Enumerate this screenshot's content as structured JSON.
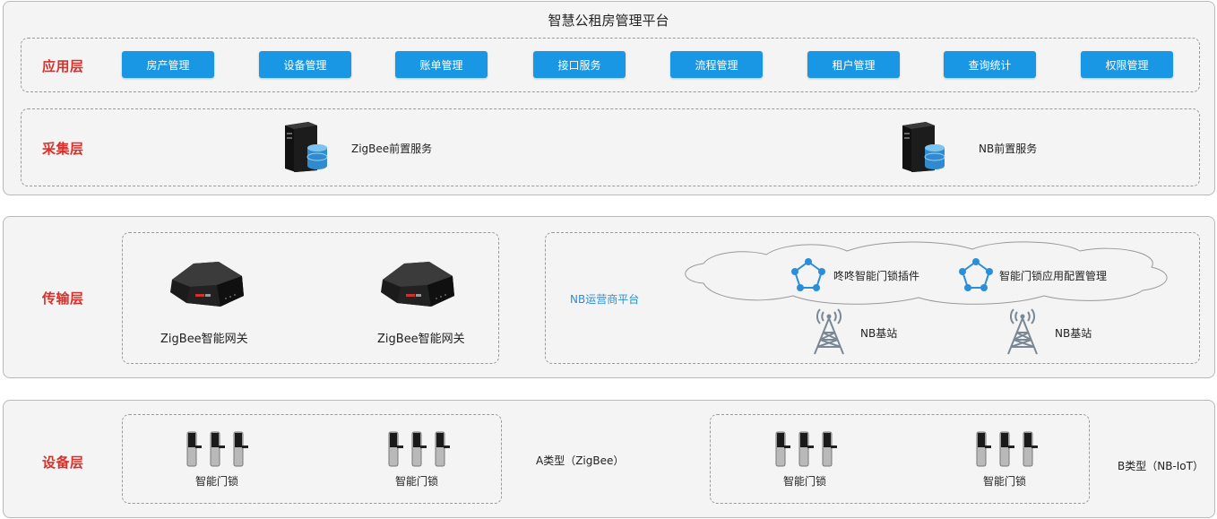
{
  "platform_title": "智慧公租房管理平台",
  "layers": {
    "application": "应用层",
    "collection": "采集层",
    "transport": "传输层",
    "device": "设备层"
  },
  "app_buttons": [
    "房产管理",
    "设备管理",
    "账单管理",
    "接口服务",
    "流程管理",
    "租户管理",
    "查询统计",
    "权限管理"
  ],
  "collection": {
    "zigbee_service": "ZigBee前置服务",
    "nb_service": "NB前置服务"
  },
  "transport": {
    "gateway_label_1": "ZigBee智能网关",
    "gateway_label_2": "ZigBee智能网关",
    "nb_platform": "NB运营商平台",
    "plugin_1": "咚咚智能门锁插件",
    "plugin_2": "智能门锁应用配置管理",
    "base_station_1": "NB基站",
    "base_station_2": "NB基站"
  },
  "device": {
    "lock_1": "智能门锁",
    "lock_2": "智能门锁",
    "lock_3": "智能门锁",
    "lock_4": "智能门锁",
    "type_a": "A类型（ZigBee）",
    "type_b": "B类型（NB-IoT）"
  },
  "colors": {
    "layer_label": "#d9302a",
    "button": "#1a97e4",
    "platform_text": "#2a8fd8"
  }
}
